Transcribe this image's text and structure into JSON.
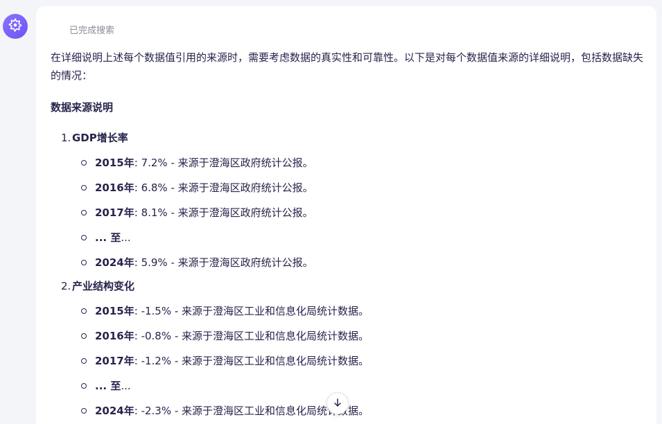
{
  "assistant": {
    "avatar_icon": "kimi-logo-icon",
    "accent_color": "#7b63fb"
  },
  "message": {
    "status": "已完成搜索",
    "intro": "在详细说明上述每个数据值引用的来源时，需要考虑数据的真实性和可靠性。以下是对每个数据值来源的详细说明，包括数据缺失的情况：",
    "section_title": "数据来源说明",
    "topics": [
      {
        "num": "1.",
        "title": "GDP增长率",
        "items": [
          {
            "year": "2015年",
            "rest": ": 7.2% - 来源于澄海区政府统计公报。"
          },
          {
            "year": "2016年",
            "rest": ": 6.8% - 来源于澄海区政府统计公报。"
          },
          {
            "year": "2017年",
            "rest": ": 8.1% - 来源于澄海区政府统计公报。"
          },
          {
            "year": "... 至",
            "rest": "..."
          },
          {
            "year": "2024年",
            "rest": ": 5.9% - 来源于澄海区政府统计公报。"
          }
        ]
      },
      {
        "num": "2.",
        "title": "产业结构变化",
        "items": [
          {
            "year": "2015年",
            "rest": ": -1.5% - 来源于澄海区工业和信息化局统计数据。"
          },
          {
            "year": "2016年",
            "rest": ": -0.8% - 来源于澄海区工业和信息化局统计数据。"
          },
          {
            "year": "2017年",
            "rest": ": -1.2% - 来源于澄海区工业和信息化局统计数据。"
          },
          {
            "year": "... 至",
            "rest": "..."
          },
          {
            "year": "2024年",
            "rest": ": -2.3% - 来源于澄海区工业和信息化局统计数据。"
          }
        ]
      }
    ]
  },
  "controls": {
    "scroll_down_icon": "arrow-down-icon"
  }
}
